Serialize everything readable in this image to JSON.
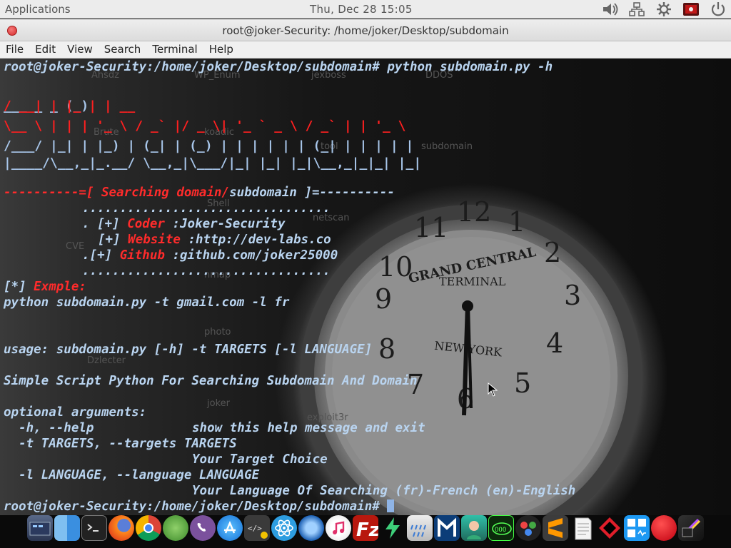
{
  "topbar": {
    "applications": "Applications",
    "datetime": "Thu, Dec 28  15:05"
  },
  "window": {
    "title": "root@joker-Security: /home/joker/Desktop/subdomain"
  },
  "menu": [
    "File",
    "Edit",
    "View",
    "Search",
    "Terminal",
    "Help"
  ],
  "terminal": {
    "prompt": "root@joker-Security:/home/joker/Desktop/subdomain#",
    "command": " python subdomain.py -h",
    "banner_title_pre": "----------=[ ",
    "banner_title_red": "Searching domain/",
    "banner_title_post": "subdomain ]=----------",
    "dots": ".................................",
    "coder_label": "Coder",
    "coder_value": " :Joker-Security",
    "website_label": "Website",
    "website_value": " :http://dev-labs.co",
    "github_label": "Github",
    "github_value": " :github.com/joker25000",
    "info_marker": "[*] ",
    "example_label": "Exmple:",
    "example_cmd": "python subdomain.py -t gmail.com -l fr",
    "usage": "usage: subdomain.py [-h] -t TARGETS [-l LANGUAGE]",
    "description": "Simple Script Python For Searching Subdomain And Domain",
    "optional_header": "optional arguments:",
    "opt_help_flag": "  -h, --help",
    "opt_help_desc": "show this help message and exit",
    "opt_targets_flag": "  -t TARGETS, --targets TARGETS",
    "opt_targets_desc": "Your Target Choice",
    "opt_lang_flag": "  -l LANGUAGE, --language LANGUAGE",
    "opt_lang_desc": "Your Language Of Searching (fr)-French (en)-English",
    "final_prompt": "root@joker-Security:/home/joker/Desktop/subdomain#"
  },
  "desktop_icons": [
    "Ahsdz",
    "WP_Enum",
    "jexboss",
    "DDOS",
    "Brute",
    "koadic",
    "tool",
    "subdomain",
    "Shell",
    "netscan",
    "CVE",
    "nmap",
    "photo",
    "Dzlecter",
    "joker",
    "exploit3r"
  ],
  "clock_text": {
    "line1": "GRAND CENTRAL",
    "line2": "TERMINAL",
    "line3": "NEW YORK"
  },
  "colors": {
    "prompt": "#b9d4f0",
    "accent_red": "#ff2b2b",
    "topbar": "#ececec"
  },
  "dock_icons": [
    "files-icon",
    "finder-icon",
    "terminal-icon",
    "firefox-icon",
    "chrome-icon",
    "network-globe-icon",
    "viber-icon",
    "app-store-icon",
    "code-editor-icon",
    "atom-icon",
    "browser-icon",
    "music-icon",
    "filezilla-icon",
    "download-icon",
    "weather-icon",
    "metasploit-icon",
    "avatar-app-icon",
    "hacking-tool-icon",
    "davinci-icon",
    "sublime-icon",
    "notes-icon",
    "red-diamond-icon",
    "kde-icon",
    "red-circle-icon",
    "final-cut-icon"
  ]
}
